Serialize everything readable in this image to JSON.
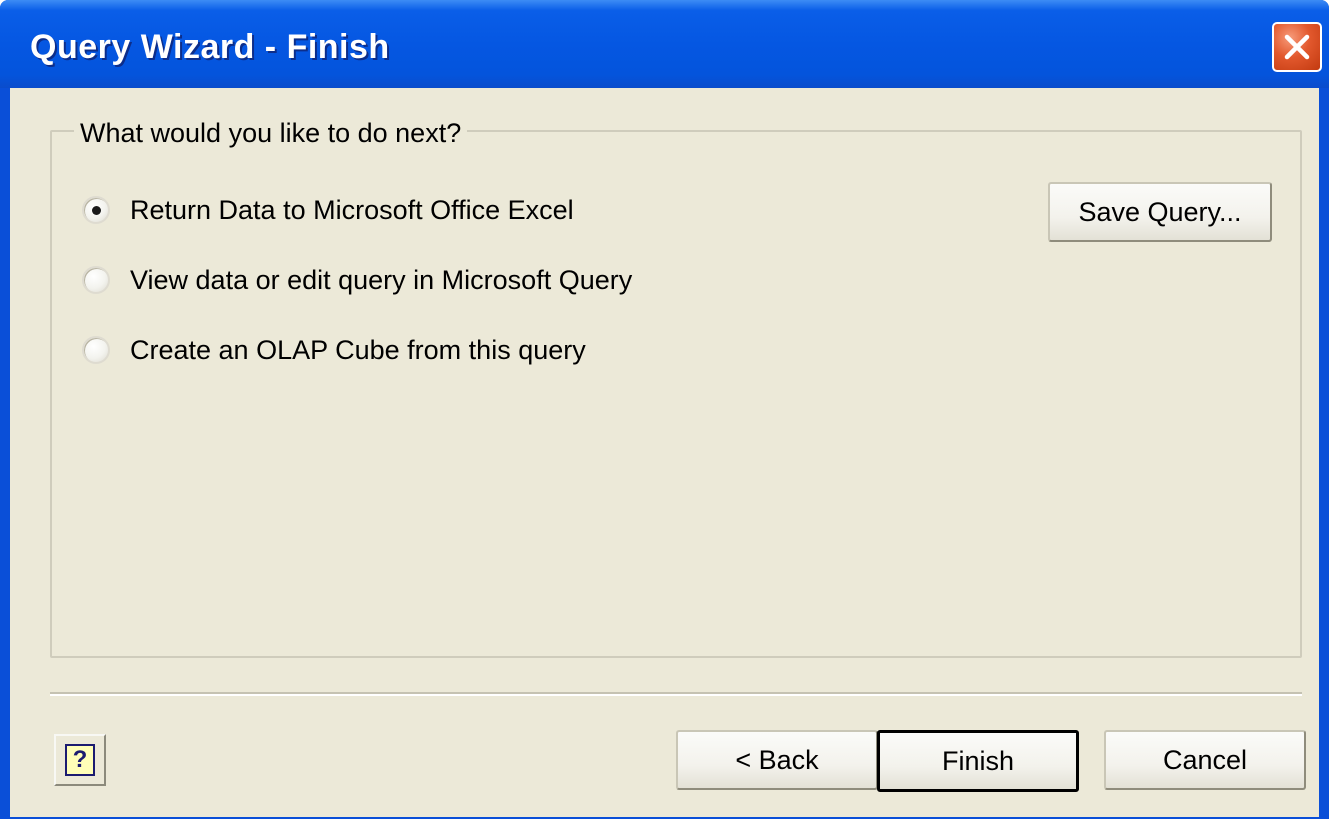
{
  "window": {
    "title": "Query Wizard - Finish"
  },
  "group": {
    "legend": "What would you like to do next?",
    "options": [
      {
        "label": "Return Data to Microsoft Office Excel",
        "checked": true
      },
      {
        "label": "View data or edit query in Microsoft Query",
        "checked": false
      },
      {
        "label": "Create an OLAP Cube from this query",
        "checked": false
      }
    ]
  },
  "buttons": {
    "save_query": "Save Query...",
    "back": "< Back",
    "finish": "Finish",
    "cancel": "Cancel",
    "help": "?"
  },
  "icons": {
    "close": "close-icon",
    "help": "help-icon"
  },
  "colors": {
    "titlebar": "#0557e2",
    "dialog_bg": "#ece9d8",
    "close_button": "#e2582d"
  }
}
